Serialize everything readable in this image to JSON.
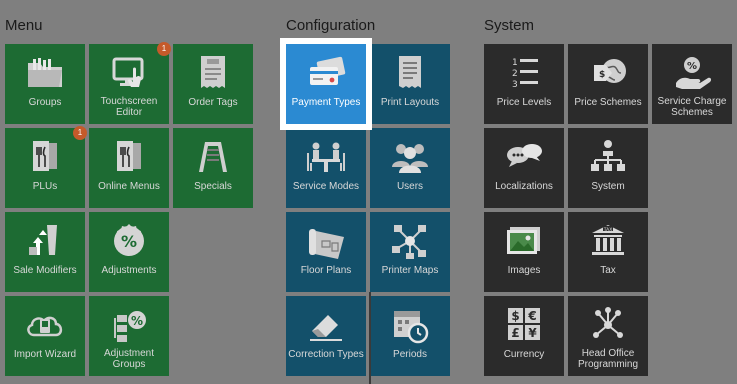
{
  "sections": {
    "menu": "Menu",
    "configuration": "Configuration",
    "system": "System"
  },
  "menu": {
    "groups": "Groups",
    "touchscreen_editor": "Touchscreen Editor",
    "touchscreen_editor_badge": "1",
    "order_tags": "Order Tags",
    "plus": "PLUs",
    "plus_badge": "1",
    "online_menus": "Online Menus",
    "specials": "Specials",
    "sale_modifiers": "Sale Modifiers",
    "adjustments": "Adjustments",
    "import_wizard": "Import Wizard",
    "adjustment_groups": "Adjustment Groups"
  },
  "configuration": {
    "payment_types": "Payment Types",
    "print_layouts": "Print Layouts",
    "service_modes": "Service Modes",
    "users": "Users",
    "floor_plans": "Floor Plans",
    "printer_maps": "Printer Maps",
    "correction_types": "Correction Types",
    "periods": "Periods"
  },
  "system": {
    "price_levels": "Price Levels",
    "price_schemes": "Price Schemes",
    "service_charge_schemes": "Service Charge Schemes",
    "localizations": "Localizations",
    "system": "System",
    "images": "Images",
    "tax": "Tax",
    "currency": "Currency",
    "head_office_programming": "Head Office Programming"
  },
  "colors": {
    "background": "#7f7f7f",
    "menu_tile": "#1d6b33",
    "configuration_tile": "#13506a",
    "system_tile": "#2b2b2b",
    "selected_tile": "#2b8ad2",
    "badge": "#c55a2a"
  },
  "icons": {
    "groups": "folder-icon",
    "touchscreen_editor": "touchscreen-icon",
    "order_tags": "receipt-tag-icon",
    "plus": "menu-card-icon",
    "online_menus": "menu-card-icon",
    "specials": "sandwich-board-icon",
    "sale_modifiers": "glasses-arrows-icon",
    "adjustments": "percent-badge-icon",
    "import_wizard": "cloud-import-icon",
    "adjustment_groups": "grouped-percent-icon",
    "payment_types": "credit-cards-icon",
    "print_layouts": "receipt-icon",
    "service_modes": "dining-table-icon",
    "users": "users-icon",
    "floor_plans": "floor-plan-icon",
    "printer_maps": "network-nodes-icon",
    "correction_types": "eraser-icon",
    "periods": "calendar-clock-icon",
    "price_levels": "numbered-list-icon",
    "price_schemes": "price-tag-globe-icon",
    "service_charge_schemes": "hand-coin-icon",
    "localizations": "speech-bubbles-icon",
    "system": "hierarchy-icon",
    "images": "image-icon",
    "tax": "tax-building-icon",
    "currency": "currency-icon",
    "head_office_programming": "node-graph-icon"
  }
}
